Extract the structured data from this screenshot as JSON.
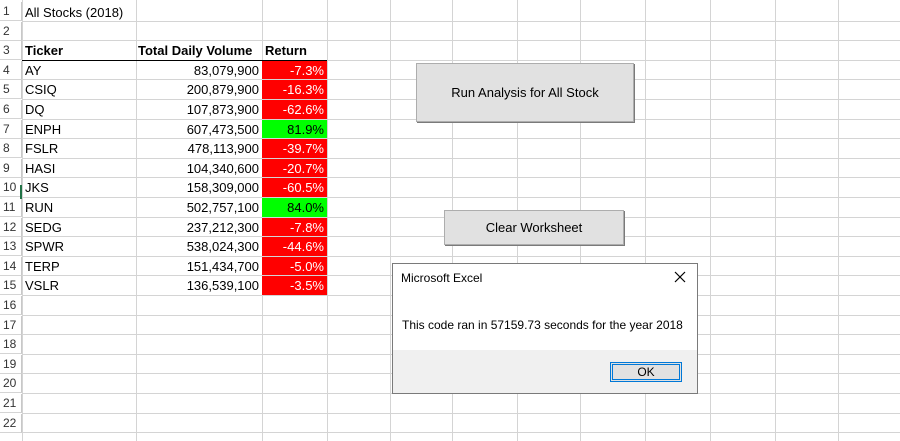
{
  "sheet": {
    "row_numbers": [
      "1",
      "2",
      "3",
      "4",
      "5",
      "6",
      "7",
      "8",
      "9",
      "10",
      "11",
      "12",
      "13",
      "14",
      "15",
      "16",
      "17",
      "18",
      "19",
      "20",
      "21",
      "22"
    ],
    "title": "All Stocks (2018)",
    "headers": {
      "ticker": "Ticker",
      "volume": "Total Daily Volume",
      "return": "Return"
    },
    "rows": [
      {
        "ticker": "AY",
        "volume": "83,079,900",
        "return": "-7.3%",
        "positive": false
      },
      {
        "ticker": "CSIQ",
        "volume": "200,879,900",
        "return": "-16.3%",
        "positive": false
      },
      {
        "ticker": "DQ",
        "volume": "107,873,900",
        "return": "-62.6%",
        "positive": false
      },
      {
        "ticker": "ENPH",
        "volume": "607,473,500",
        "return": "81.9%",
        "positive": true
      },
      {
        "ticker": "FSLR",
        "volume": "478,113,900",
        "return": "-39.7%",
        "positive": false
      },
      {
        "ticker": "HASI",
        "volume": "104,340,600",
        "return": "-20.7%",
        "positive": false
      },
      {
        "ticker": "JKS",
        "volume": "158,309,000",
        "return": "-60.5%",
        "positive": false
      },
      {
        "ticker": "RUN",
        "volume": "502,757,100",
        "return": "84.0%",
        "positive": true
      },
      {
        "ticker": "SEDG",
        "volume": "237,212,300",
        "return": "-7.8%",
        "positive": false
      },
      {
        "ticker": "SPWR",
        "volume": "538,024,300",
        "return": "-44.6%",
        "positive": false
      },
      {
        "ticker": "TERP",
        "volume": "151,434,700",
        "return": "-5.0%",
        "positive": false
      },
      {
        "ticker": "VSLR",
        "volume": "136,539,100",
        "return": "-3.5%",
        "positive": false
      }
    ],
    "colors": {
      "negative": "#ff0000",
      "positive": "#00ff00",
      "grid": "#d4d4d4"
    }
  },
  "buttons": {
    "run_analysis": "Run Analysis for All Stock",
    "clear_worksheet": "Clear Worksheet"
  },
  "dialog": {
    "title": "Microsoft Excel",
    "message": "This code ran in 57159.73 seconds for the year 2018",
    "ok_label": "OK",
    "close_icon": "close-icon"
  }
}
